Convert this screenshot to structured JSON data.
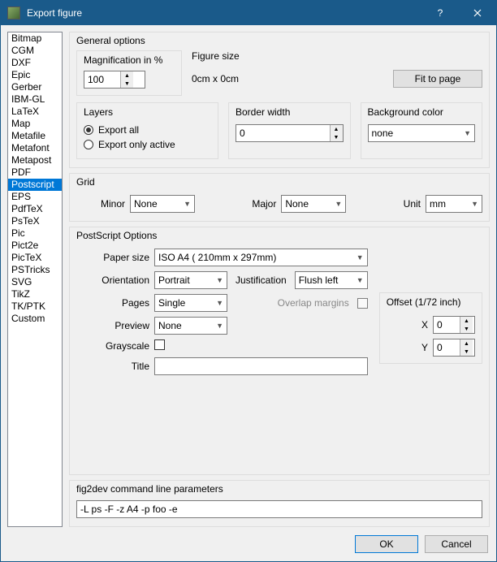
{
  "window": {
    "title": "Export figure"
  },
  "sidebar": {
    "items": [
      "Bitmap",
      "CGM",
      "DXF",
      "Epic",
      "Gerber",
      "IBM-GL",
      "LaTeX",
      "Map",
      "Metafile",
      "Metafont",
      "Metapost",
      "PDF",
      "Postscript",
      "EPS",
      "PdfTeX",
      "PsTeX",
      "Pic",
      "Pict2e",
      "PicTeX",
      "PSTricks",
      "SVG",
      "TikZ",
      "TK/PTK",
      "Custom"
    ],
    "selected_index": 12
  },
  "general": {
    "groupTitle": "General options",
    "magSub": "Magnification in %",
    "magValue": "100",
    "figSub": "Figure size",
    "figValue": "0cm x 0cm",
    "fitBtn": "Fit to page",
    "layersSub": "Layers",
    "exportAll": "Export all",
    "exportActive": "Export only active",
    "borderSub": "Border width",
    "borderValue": "0",
    "bgSub": "Background color",
    "bgValue": "none"
  },
  "grid": {
    "groupTitle": "Grid",
    "minorLabel": "Minor",
    "minorValue": "None",
    "majorLabel": "Major",
    "majorValue": "None",
    "unitLabel": "Unit",
    "unitValue": "mm"
  },
  "ps": {
    "groupTitle": "PostScript Options",
    "paperLabel": "Paper size",
    "paperValue": "ISO A4  ( 210mm x  297mm)",
    "orientLabel": "Orientation",
    "orientValue": "Portrait",
    "justLabel": "Justification",
    "justValue": "Flush left",
    "pagesLabel": "Pages",
    "pagesValue": "Single",
    "overlapLabel": "Overlap margins",
    "previewLabel": "Preview",
    "previewValue": "None",
    "grayscaleLabel": "Grayscale",
    "titleLabel": "Title",
    "titleValue": "",
    "offsetSub": "Offset (1/72 inch)",
    "offsetXLabel": "X",
    "offsetXValue": "0",
    "offsetYLabel": "Y",
    "offsetYValue": "0"
  },
  "cmd": {
    "groupTitle": "fig2dev command line parameters",
    "value": "-L ps -F -z A4 -p foo -e "
  },
  "buttons": {
    "ok": "OK",
    "cancel": "Cancel"
  }
}
